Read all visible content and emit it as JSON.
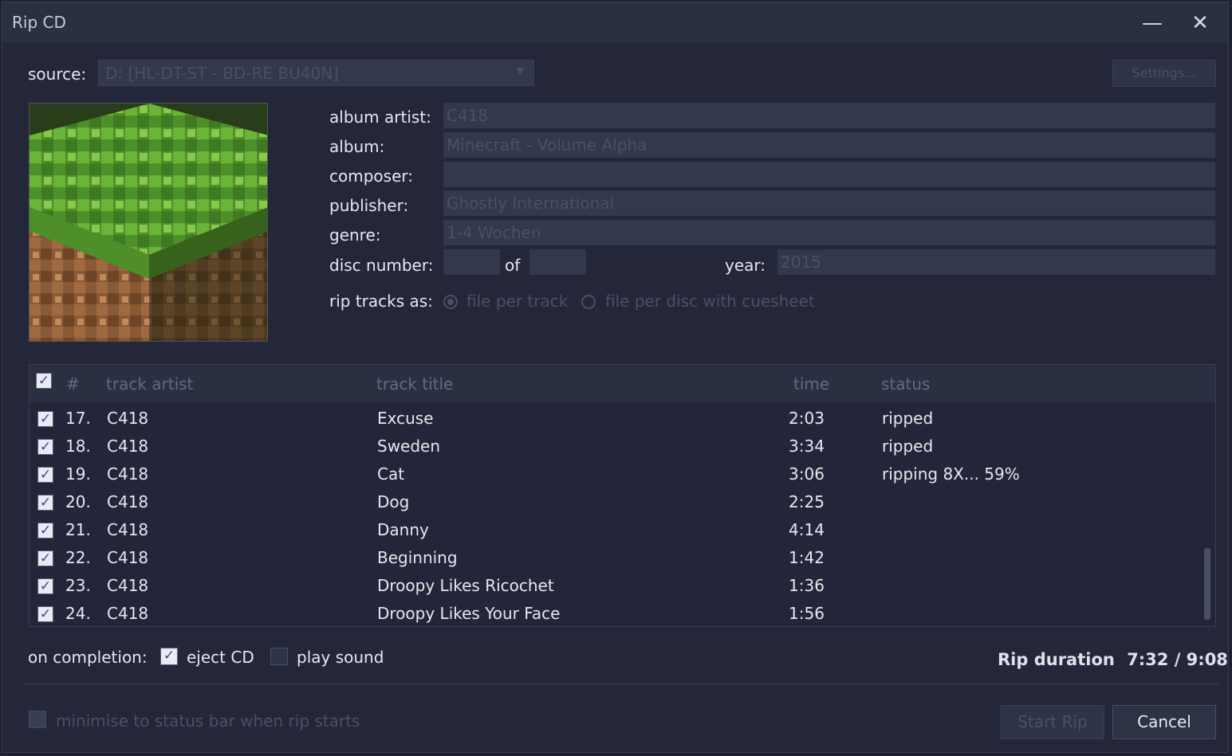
{
  "window": {
    "title": "Rip CD"
  },
  "source": {
    "label": "source:",
    "value": "D: [HL-DT-ST - BD-RE  BU40N]",
    "settings_label": "Settings..."
  },
  "fields": {
    "album_artist": {
      "label": "album artist:",
      "value": "C418"
    },
    "album": {
      "label": "album:",
      "value": "Minecraft - Volume Alpha"
    },
    "composer": {
      "label": "composer:",
      "value": ""
    },
    "publisher": {
      "label": "publisher:",
      "value": "Ghostly International"
    },
    "genre": {
      "label": "genre:",
      "value": "1-4 Wochen"
    },
    "disc_number": {
      "label": "disc number:",
      "value": "",
      "of_label": "of",
      "of_value": ""
    },
    "year": {
      "label": "year:",
      "value": "2015"
    }
  },
  "rip_as": {
    "label": "rip tracks as:",
    "option1": "file per track",
    "option2": "file per disc with cuesheet",
    "selected": "file per track"
  },
  "table": {
    "headers": {
      "num": "#",
      "artist": "track artist",
      "title": "track title",
      "time": "time",
      "status": "status"
    },
    "rows": [
      {
        "num": "17.",
        "artist": "C418",
        "title": "Excuse",
        "time": "2:03",
        "status": "ripped",
        "checked": true
      },
      {
        "num": "18.",
        "artist": "C418",
        "title": "Sweden",
        "time": "3:34",
        "status": "ripped",
        "checked": true
      },
      {
        "num": "19.",
        "artist": "C418",
        "title": "Cat",
        "time": "3:06",
        "status": "ripping 8X... 59%",
        "checked": true
      },
      {
        "num": "20.",
        "artist": "C418",
        "title": "Dog",
        "time": "2:25",
        "status": "",
        "checked": true
      },
      {
        "num": "21.",
        "artist": "C418",
        "title": "Danny",
        "time": "4:14",
        "status": "",
        "checked": true
      },
      {
        "num": "22.",
        "artist": "C418",
        "title": "Beginning",
        "time": "1:42",
        "status": "",
        "checked": true
      },
      {
        "num": "23.",
        "artist": "C418",
        "title": "Droopy Likes Ricochet",
        "time": "1:36",
        "status": "",
        "checked": true
      },
      {
        "num": "24.",
        "artist": "C418",
        "title": "Droopy Likes Your Face",
        "time": "1:56",
        "status": "",
        "checked": true
      }
    ]
  },
  "completion": {
    "label": "on completion:",
    "eject_label": "eject CD",
    "eject_checked": true,
    "sound_label": "play sound",
    "sound_checked": false
  },
  "duration": {
    "label": "Rip duration",
    "value": "7:32 / 9:08"
  },
  "footer": {
    "minimise_label": "minimise to status bar when rip starts",
    "start_label": "Start Rip",
    "cancel_label": "Cancel"
  },
  "icons": [
    "minimize-icon",
    "close-icon",
    "dropdown-arrow-icon",
    "check-icon"
  ]
}
